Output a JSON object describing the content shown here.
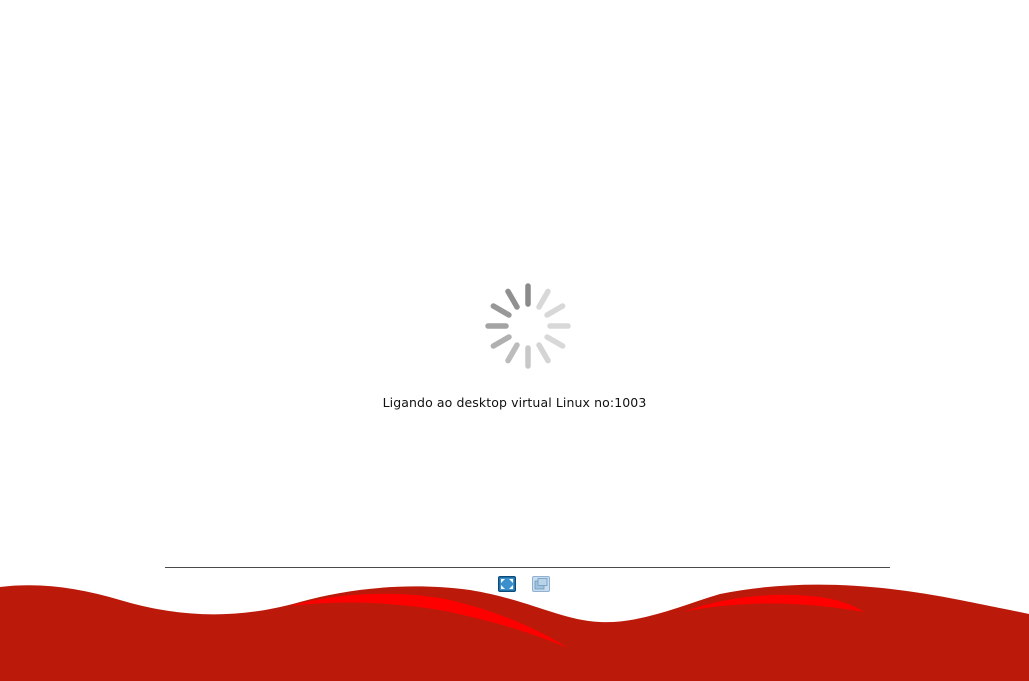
{
  "status": {
    "message": "Ligando ao desktop virtual Linux no:1003"
  },
  "toolbar": {
    "fullscreen_icon": "fullscreen-icon",
    "window_icon": "restore-window-icon"
  },
  "colors": {
    "background": "#ffffff",
    "wave_dark_red": "#bb1a0a",
    "wave_bright_red": "#ff0000",
    "divider": "#4a4a4a",
    "fullscreen_button": "#1f6fa8",
    "window_button": "#9fc2de"
  },
  "spinner": {
    "icon": "loading-spinner-icon"
  }
}
